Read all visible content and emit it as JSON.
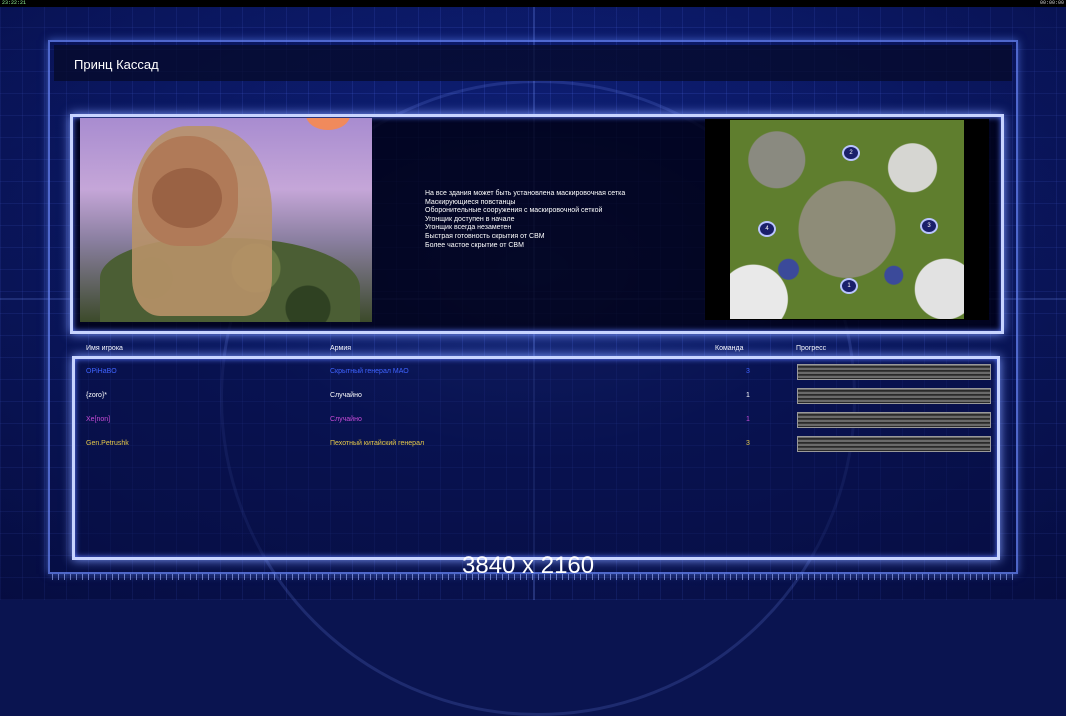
{
  "status_bar": {
    "left_clock": "23:22:21",
    "right_clock": "00:00:00"
  },
  "header": {
    "title": "Принц Кассад"
  },
  "general_features": [
    "На все здания может быть установлена маскировочная сетка",
    "Маскирующиеся повстанцы",
    "Оборонительные сооружения с маскировочной сеткой",
    "Угонщик доступен в начале",
    "Угонщик всегда незаметен",
    "Быстрая готовность скрытия от СВМ",
    "Более частое скрытие от СВМ"
  ],
  "map": {
    "spawn_points": [
      "1",
      "2",
      "3",
      "4"
    ]
  },
  "players_table": {
    "headers": {
      "player": "Имя игрока",
      "army": "Армия",
      "team": "Команда",
      "progress": "Прогресс"
    },
    "rows": [
      {
        "player": "OPiHaBO",
        "army": "Скрытный генерал МАО",
        "team": "3",
        "color": "#3f63ff",
        "progress": 1.0
      },
      {
        "player": "{zoro}*",
        "army": "Случайно",
        "team": "1",
        "color": "#ffffff",
        "progress": 1.0
      },
      {
        "player": "Xe[non]",
        "army": "Случайно",
        "team": "1",
        "color": "#c84bd8",
        "progress": 1.0
      },
      {
        "player": "Gen.Petrushk",
        "army": "Пехотный китайский генерал",
        "team": "3",
        "color": "#e6c94a",
        "progress": 1.0
      }
    ]
  },
  "watermark": "3840 x 2160"
}
